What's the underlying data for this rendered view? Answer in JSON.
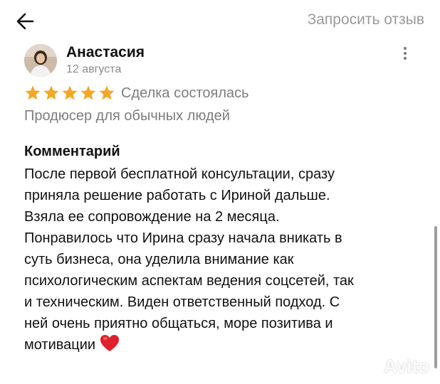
{
  "header": {
    "back_icon": "arrow-left-icon",
    "request_review_label": "Запросить отзыв"
  },
  "review": {
    "author_name": "Анастасия",
    "date": "12 августа",
    "rating": 5,
    "rating_max": 5,
    "star_color": "#F5A623",
    "deal_status": "Сделка состоялась",
    "service_name": "Продюсер для обычных людей",
    "comment_heading": "Комментарий",
    "comment_lines": [
      "После первой бесплатной консультации, сразу",
      "приняла решение работать с Ириной дальше.",
      "Взяла ее сопровождение на 2 месяца.",
      "Понравилось что Ирина сразу начала вникать в",
      "суть бизнеса, она уделила внимание как",
      "психологическим аспектам ведения соцсетей, так",
      "и техническим. Виден ответственный подход. С",
      "ней очень приятно общаться, море позитива и",
      "мотивации"
    ],
    "comment_emoji": "heart-icon"
  },
  "watermark_text": "Avito"
}
